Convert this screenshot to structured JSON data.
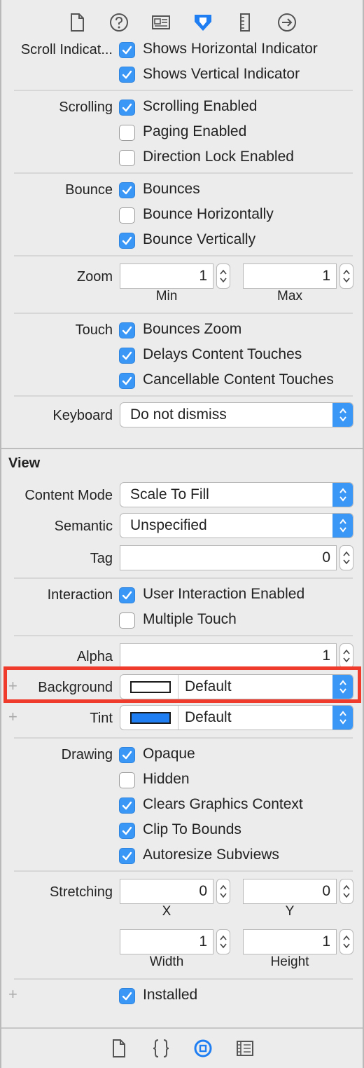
{
  "toolbar": {
    "icons": [
      "file-icon",
      "help-icon",
      "identity-icon",
      "attributes-icon",
      "size-icon",
      "connections-icon"
    ],
    "active": "attributes-icon",
    "accent": "#1f7ef2"
  },
  "scroll_view": {
    "scroll_indicators": {
      "label": "Scroll Indicat...",
      "horizontal": "Shows Horizontal Indicator",
      "vertical": "Shows Vertical Indicator"
    },
    "scrolling": {
      "label": "Scrolling",
      "enabled": "Scrolling Enabled",
      "paging": "Paging Enabled",
      "direction_lock": "Direction Lock Enabled"
    },
    "bounce": {
      "label": "Bounce",
      "bounces": "Bounces",
      "horizontally": "Bounce Horizontally",
      "vertically": "Bounce Vertically"
    },
    "zoom": {
      "label": "Zoom",
      "min_value": "1",
      "max_value": "1",
      "min_label": "Min",
      "max_label": "Max"
    },
    "touch": {
      "label": "Touch",
      "bounces_zoom": "Bounces Zoom",
      "delays": "Delays Content Touches",
      "cancellable": "Cancellable Content Touches"
    },
    "keyboard": {
      "label": "Keyboard",
      "value": "Do not dismiss"
    }
  },
  "view": {
    "title": "View",
    "content_mode": {
      "label": "Content Mode",
      "value": "Scale To Fill"
    },
    "semantic": {
      "label": "Semantic",
      "value": "Unspecified"
    },
    "tag": {
      "label": "Tag",
      "value": "0"
    },
    "interaction": {
      "label": "Interaction",
      "user_interaction": "User Interaction Enabled",
      "multiple_touch": "Multiple Touch"
    },
    "alpha": {
      "label": "Alpha",
      "value": "1"
    },
    "background": {
      "plus": "+",
      "label": "Background",
      "value": "Default",
      "swatch": "#ffffff"
    },
    "tint": {
      "plus": "+",
      "label": "Tint",
      "value": "Default",
      "swatch": "#1f7ef2"
    },
    "drawing": {
      "label": "Drawing",
      "opaque": "Opaque",
      "hidden": "Hidden",
      "clears": "Clears Graphics Context",
      "clip": "Clip To Bounds",
      "autoresize": "Autoresize Subviews"
    },
    "stretching": {
      "label": "Stretching",
      "x_value": "0",
      "y_value": "0",
      "width_value": "1",
      "height_value": "1",
      "x_label": "X",
      "y_label": "Y",
      "width_label": "Width",
      "height_label": "Height"
    },
    "installed": {
      "plus": "+",
      "label": "Installed"
    }
  },
  "bottom_bar": {
    "icons": [
      "file-template-icon",
      "code-snippet-icon",
      "object-library-icon",
      "media-library-icon"
    ],
    "active": "object-library-icon"
  },
  "colors": {
    "checkbox_on": "#3b97f6",
    "highlight": "#ee3b2b"
  }
}
